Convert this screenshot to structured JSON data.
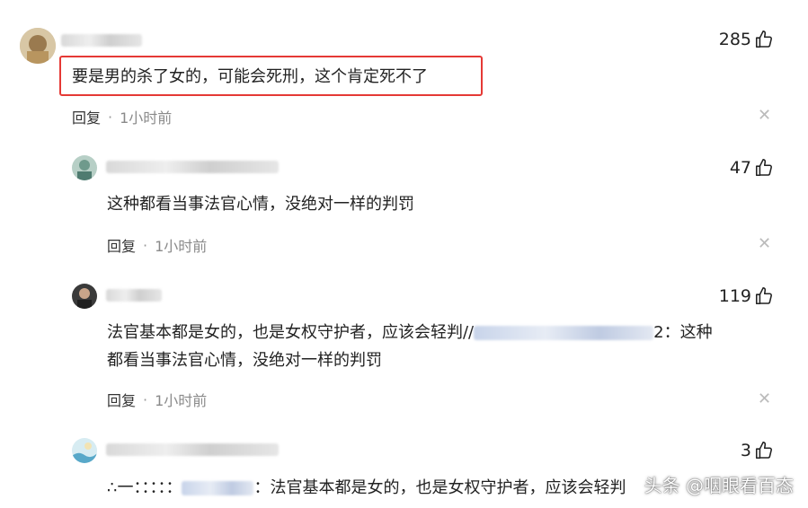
{
  "comments": [
    {
      "likes": "285",
      "text": "要是男的杀了女的，可能会死刑，这个肯定死不了",
      "reply_label": "回复",
      "time": "1小时前"
    },
    {
      "likes": "47",
      "text": "这种都看当事法官心情，没绝对一样的判罚",
      "reply_label": "回复",
      "time": "1小时前"
    },
    {
      "likes": "119",
      "text_line1_a": "法官基本都是女的，也是女权守护者，应该会轻判//",
      "text_line1_b": "2：这种",
      "text_line2": "都看当事法官心情，没绝对一样的判罚",
      "reply_label": "回复",
      "time": "1小时前"
    },
    {
      "likes": "3",
      "text_prefix": "∴一：：：：：",
      "text_main": "：法官基本都是女的，也是女权守护者，应该会轻判"
    }
  ],
  "watermark": "头条 @咽眼看百态",
  "colors": {
    "highlight": "#e53935",
    "meta_time": "#8a8a8a",
    "close": "#bbbbbb"
  },
  "icons": {
    "like": "thumbs-up-icon",
    "close": "close-icon"
  }
}
